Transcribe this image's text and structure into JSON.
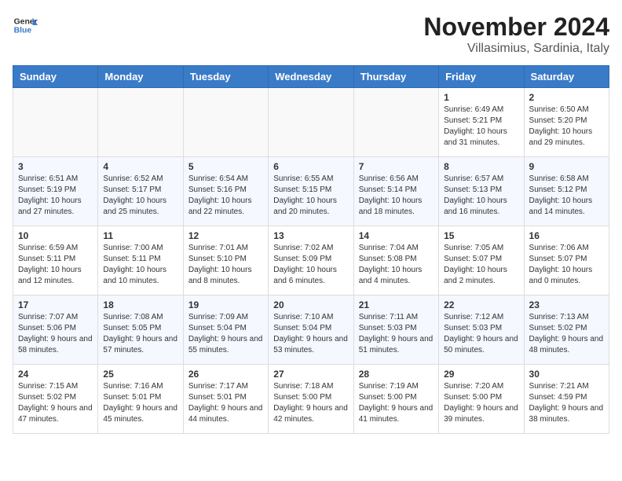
{
  "header": {
    "logo_general": "General",
    "logo_blue": "Blue",
    "month_year": "November 2024",
    "location": "Villasimius, Sardinia, Italy"
  },
  "days_of_week": [
    "Sunday",
    "Monday",
    "Tuesday",
    "Wednesday",
    "Thursday",
    "Friday",
    "Saturday"
  ],
  "weeks": [
    [
      {
        "day": "",
        "info": ""
      },
      {
        "day": "",
        "info": ""
      },
      {
        "day": "",
        "info": ""
      },
      {
        "day": "",
        "info": ""
      },
      {
        "day": "",
        "info": ""
      },
      {
        "day": "1",
        "info": "Sunrise: 6:49 AM\nSunset: 5:21 PM\nDaylight: 10 hours and 31 minutes."
      },
      {
        "day": "2",
        "info": "Sunrise: 6:50 AM\nSunset: 5:20 PM\nDaylight: 10 hours and 29 minutes."
      }
    ],
    [
      {
        "day": "3",
        "info": "Sunrise: 6:51 AM\nSunset: 5:19 PM\nDaylight: 10 hours and 27 minutes."
      },
      {
        "day": "4",
        "info": "Sunrise: 6:52 AM\nSunset: 5:17 PM\nDaylight: 10 hours and 25 minutes."
      },
      {
        "day": "5",
        "info": "Sunrise: 6:54 AM\nSunset: 5:16 PM\nDaylight: 10 hours and 22 minutes."
      },
      {
        "day": "6",
        "info": "Sunrise: 6:55 AM\nSunset: 5:15 PM\nDaylight: 10 hours and 20 minutes."
      },
      {
        "day": "7",
        "info": "Sunrise: 6:56 AM\nSunset: 5:14 PM\nDaylight: 10 hours and 18 minutes."
      },
      {
        "day": "8",
        "info": "Sunrise: 6:57 AM\nSunset: 5:13 PM\nDaylight: 10 hours and 16 minutes."
      },
      {
        "day": "9",
        "info": "Sunrise: 6:58 AM\nSunset: 5:12 PM\nDaylight: 10 hours and 14 minutes."
      }
    ],
    [
      {
        "day": "10",
        "info": "Sunrise: 6:59 AM\nSunset: 5:11 PM\nDaylight: 10 hours and 12 minutes."
      },
      {
        "day": "11",
        "info": "Sunrise: 7:00 AM\nSunset: 5:11 PM\nDaylight: 10 hours and 10 minutes."
      },
      {
        "day": "12",
        "info": "Sunrise: 7:01 AM\nSunset: 5:10 PM\nDaylight: 10 hours and 8 minutes."
      },
      {
        "day": "13",
        "info": "Sunrise: 7:02 AM\nSunset: 5:09 PM\nDaylight: 10 hours and 6 minutes."
      },
      {
        "day": "14",
        "info": "Sunrise: 7:04 AM\nSunset: 5:08 PM\nDaylight: 10 hours and 4 minutes."
      },
      {
        "day": "15",
        "info": "Sunrise: 7:05 AM\nSunset: 5:07 PM\nDaylight: 10 hours and 2 minutes."
      },
      {
        "day": "16",
        "info": "Sunrise: 7:06 AM\nSunset: 5:07 PM\nDaylight: 10 hours and 0 minutes."
      }
    ],
    [
      {
        "day": "17",
        "info": "Sunrise: 7:07 AM\nSunset: 5:06 PM\nDaylight: 9 hours and 58 minutes."
      },
      {
        "day": "18",
        "info": "Sunrise: 7:08 AM\nSunset: 5:05 PM\nDaylight: 9 hours and 57 minutes."
      },
      {
        "day": "19",
        "info": "Sunrise: 7:09 AM\nSunset: 5:04 PM\nDaylight: 9 hours and 55 minutes."
      },
      {
        "day": "20",
        "info": "Sunrise: 7:10 AM\nSunset: 5:04 PM\nDaylight: 9 hours and 53 minutes."
      },
      {
        "day": "21",
        "info": "Sunrise: 7:11 AM\nSunset: 5:03 PM\nDaylight: 9 hours and 51 minutes."
      },
      {
        "day": "22",
        "info": "Sunrise: 7:12 AM\nSunset: 5:03 PM\nDaylight: 9 hours and 50 minutes."
      },
      {
        "day": "23",
        "info": "Sunrise: 7:13 AM\nSunset: 5:02 PM\nDaylight: 9 hours and 48 minutes."
      }
    ],
    [
      {
        "day": "24",
        "info": "Sunrise: 7:15 AM\nSunset: 5:02 PM\nDaylight: 9 hours and 47 minutes."
      },
      {
        "day": "25",
        "info": "Sunrise: 7:16 AM\nSunset: 5:01 PM\nDaylight: 9 hours and 45 minutes."
      },
      {
        "day": "26",
        "info": "Sunrise: 7:17 AM\nSunset: 5:01 PM\nDaylight: 9 hours and 44 minutes."
      },
      {
        "day": "27",
        "info": "Sunrise: 7:18 AM\nSunset: 5:00 PM\nDaylight: 9 hours and 42 minutes."
      },
      {
        "day": "28",
        "info": "Sunrise: 7:19 AM\nSunset: 5:00 PM\nDaylight: 9 hours and 41 minutes."
      },
      {
        "day": "29",
        "info": "Sunrise: 7:20 AM\nSunset: 5:00 PM\nDaylight: 9 hours and 39 minutes."
      },
      {
        "day": "30",
        "info": "Sunrise: 7:21 AM\nSunset: 4:59 PM\nDaylight: 9 hours and 38 minutes."
      }
    ]
  ]
}
